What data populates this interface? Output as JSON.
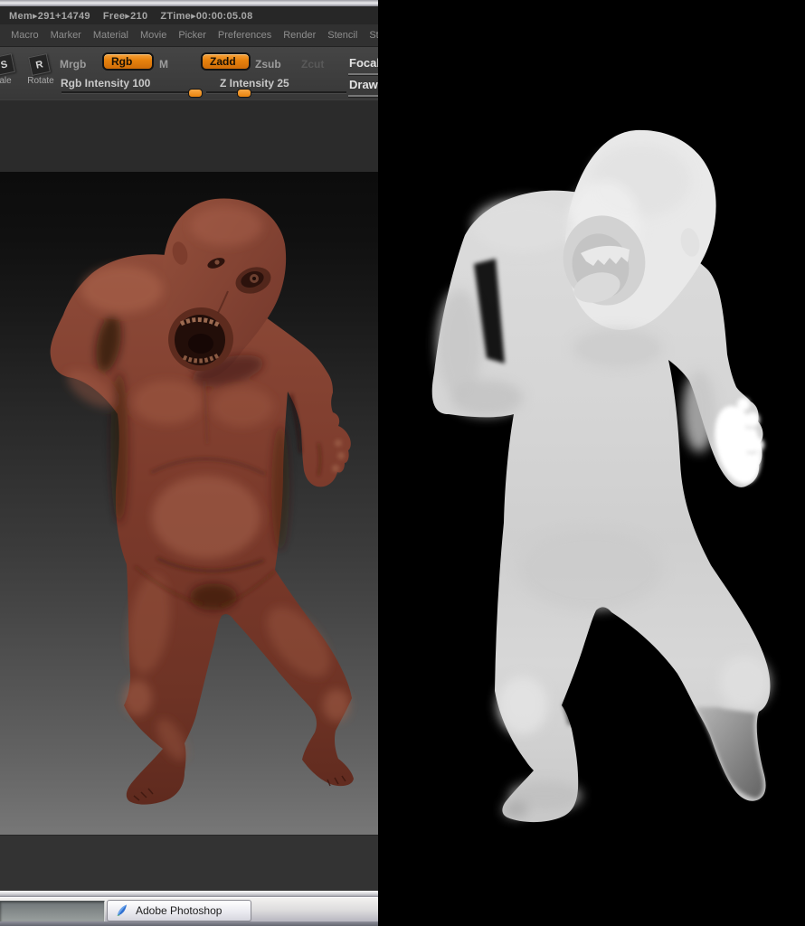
{
  "stats_bar": {
    "items": [
      "Mem▸291+14749",
      "Free▸210",
      "ZTime▸00:00:05.08"
    ]
  },
  "menu_bar": {
    "clipped_item": "t",
    "items": [
      "Macro",
      "Marker",
      "Material",
      "Movie",
      "Picker",
      "Preferences",
      "Render",
      "Stencil",
      "Stroke"
    ]
  },
  "toolbar": {
    "side_buttons": [
      {
        "icon_letter": "S",
        "label": "ale"
      },
      {
        "icon_letter": "R",
        "label": "Rotate"
      }
    ],
    "mode_buttons": [
      {
        "label": "Mrgb",
        "state": "normal"
      },
      {
        "label": "Rgb",
        "state": "active"
      },
      {
        "label": "M",
        "state": "normal"
      },
      {
        "label": "Zadd",
        "state": "active"
      },
      {
        "label": "Zsub",
        "state": "normal"
      },
      {
        "label": "Zcut",
        "state": "disabled"
      }
    ],
    "focal_label": "Focal",
    "draw_label": "Draw",
    "sliders": [
      {
        "label": "Rgb Intensity 100",
        "value": 100,
        "handle_pct": 91
      },
      {
        "label": "Z Intensity 25",
        "value": 25,
        "handle_pct": 22
      }
    ]
  },
  "canvas": {
    "content": "red clay sculpt of a screaming humanoid figure in crouched pose"
  },
  "depth_view": {
    "content": "grayscale depth matte of the same screaming figure on black"
  },
  "taskbar": {
    "app_button": "Adobe Photoshop"
  },
  "colors": {
    "accent_orange": "#e8830e",
    "ui_dark": "#2b2b2b",
    "toolbar_gray": "#3c3c3c",
    "sculpt_red": "#7a3a2b",
    "depth_gray": "#d6d6d6"
  }
}
